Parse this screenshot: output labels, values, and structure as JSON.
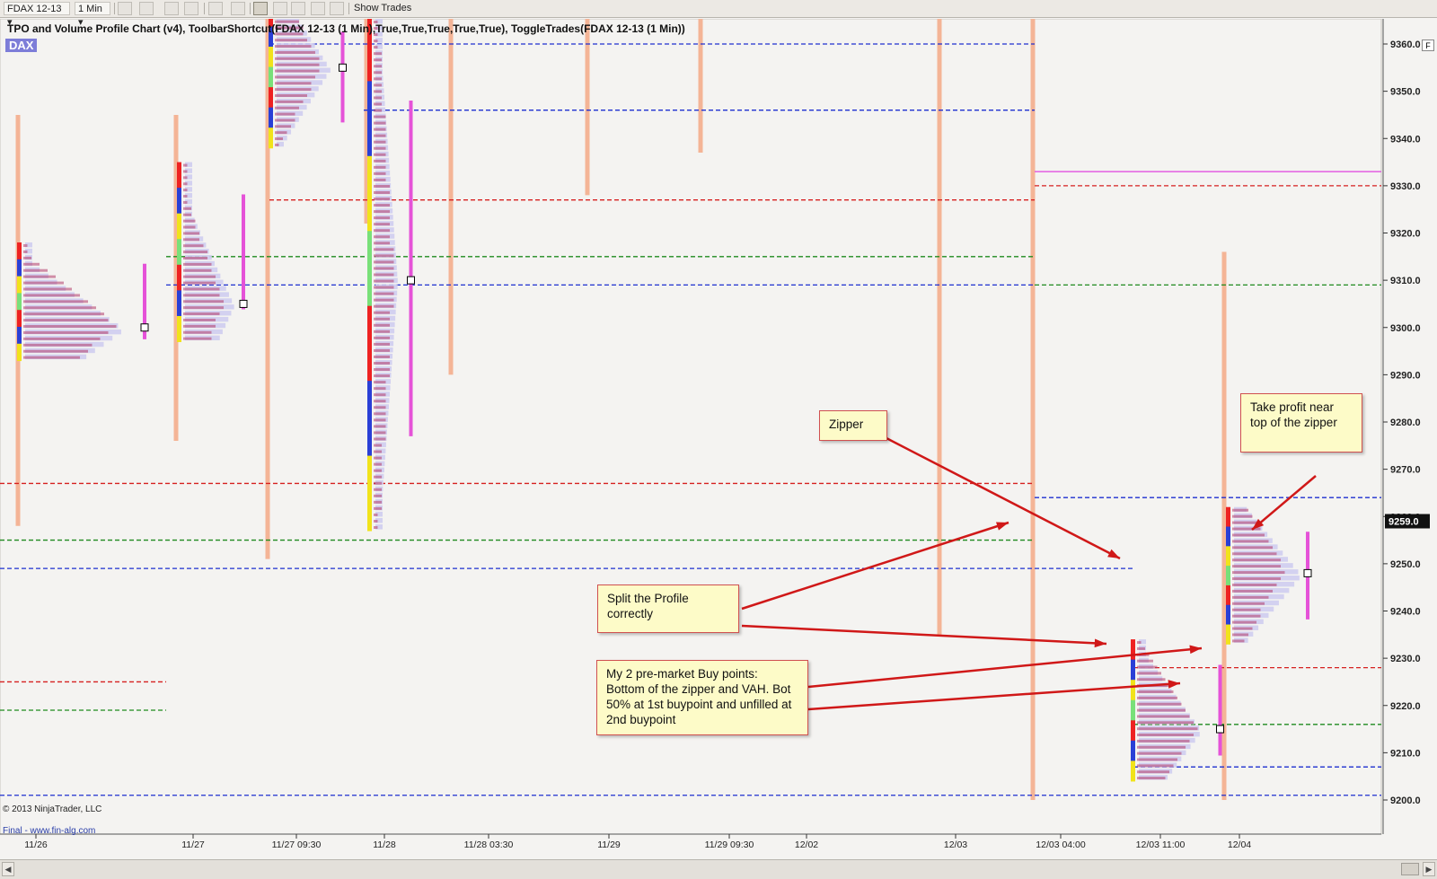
{
  "toolbar": {
    "instrument": "FDAX 12-13",
    "interval": "1 Min",
    "show_trades": "Show Trades"
  },
  "chart": {
    "title": "TPO and Volume Profile Chart (v4), ToolbarShortcut(FDAX 12-13 (1 Min),True,True,True,True,True), ToggleTrades(FDAX 12-13 (1 Min))",
    "instrument_label": "DAX",
    "copyright": "© 2013 NinjaTrader, LLC",
    "footer_link": "Final - www.fin-alg.com",
    "current_price_label": "9259.0",
    "corner_label": "F"
  },
  "chart_data": {
    "type": "tpo-profile",
    "ylim": [
      9197,
      9368
    ],
    "y_ticks": [
      9200,
      9210,
      9220,
      9230,
      9240,
      9250,
      9260,
      9270,
      9280,
      9290,
      9300,
      9310,
      9320,
      9330,
      9340,
      9350,
      9360
    ],
    "y_tick_labels": [
      "9200.0",
      "9210.0",
      "9220.0",
      "9230.0",
      "9240.0",
      "9250.0",
      "9260.0",
      "9270.0",
      "9280.0",
      "9290.0",
      "9300.0",
      "9310.0",
      "9320.0",
      "9330.0",
      "9340.0",
      "9350.0",
      "9360.0"
    ],
    "x_tick_labels": [
      "11/26",
      "11/27",
      "11/27 09:30",
      "11/28",
      "11/28 03:30",
      "11/29",
      "11/29 09:30",
      "12/02",
      "12/03",
      "12/03 04:00",
      "12/03 11:00",
      "12/04"
    ],
    "current_price": 9259.0,
    "range_bars": [
      {
        "high": 9345,
        "low": 9258,
        "color": "#f4b496"
      },
      {
        "high": 9345,
        "low": 9276,
        "color": "#f4b496"
      },
      {
        "high": 9368,
        "low": 9251,
        "color": "#f4b496"
      },
      {
        "high": 9368,
        "low": 9322,
        "color": "#f4b496"
      },
      {
        "high": 9368,
        "low": 9290,
        "color": "#f4b496"
      },
      {
        "high": 9368,
        "low": 9328,
        "color": "#f4b496"
      },
      {
        "high": 9368,
        "low": 9337,
        "color": "#f4b496"
      },
      {
        "high": 9368,
        "low": 9235,
        "color": "#f4b496"
      },
      {
        "high": 9368,
        "low": 9200,
        "color": "#f4b496"
      },
      {
        "high": 9316,
        "low": 9200,
        "color": "#f4b496"
      }
    ],
    "levels": [
      {
        "price": 9360,
        "color": "#1d2fd0",
        "from": "11/27 09:30",
        "to": "12/03 04:00"
      },
      {
        "price": 9346,
        "color": "#1d2fd0",
        "from": "11/28",
        "to": "12/03 04:00"
      },
      {
        "price": 9330,
        "color": "#d62020",
        "from": "12/03 04:00",
        "to": "end"
      },
      {
        "price": 9327,
        "color": "#d62020",
        "from": "11/27 09:30",
        "to": "12/03 04:00"
      },
      {
        "price": 9315,
        "color": "#1e8a1e",
        "from": "11/27",
        "to": "12/03 04:00"
      },
      {
        "price": 9309,
        "color": "#1d2fd0",
        "from": "11/27",
        "to": "12/03 04:00"
      },
      {
        "price": 9309,
        "color": "#1e8a1e",
        "from": "12/03 04:00",
        "to": "end"
      },
      {
        "price": 9267,
        "color": "#d62020",
        "from": "start",
        "to": "12/03 04:00"
      },
      {
        "price": 9264,
        "color": "#1d2fd0",
        "from": "12/03 04:00",
        "to": "end"
      },
      {
        "price": 9255,
        "color": "#1e8a1e",
        "from": "start",
        "to": "12/03 04:00"
      },
      {
        "price": 9249,
        "color": "#1d2fd0",
        "from": "start",
        "to": "12/03 11:00"
      },
      {
        "price": 9228,
        "color": "#d62020",
        "from": "12/03 11:00",
        "to": "end"
      },
      {
        "price": 9225,
        "color": "#d62020",
        "from": "start",
        "to": "11/27"
      },
      {
        "price": 9219,
        "color": "#1e8a1e",
        "from": "start",
        "to": "11/27"
      },
      {
        "price": 9216,
        "color": "#1e8a1e",
        "from": "12/03 11:00",
        "to": "end"
      },
      {
        "price": 9207,
        "color": "#1d2fd0",
        "from": "12/03 11:00",
        "to": "end"
      },
      {
        "price": 9201,
        "color": "#1d2fd0",
        "from": "start",
        "to": "end"
      },
      {
        "price": 9333,
        "color": "#e040e0",
        "from": "12/03 04:00",
        "to": "end"
      }
    ],
    "profiles": [
      {
        "top": 9318,
        "bottom": 9293,
        "poc": 9300
      },
      {
        "top": 9335,
        "bottom": 9297,
        "poc": 9305
      },
      {
        "top": 9368,
        "bottom": 9338,
        "poc": 9355
      },
      {
        "top": 9368,
        "bottom": 9257,
        "poc": 9310
      },
      {
        "top": 9234,
        "bottom": 9204,
        "poc": 9215
      },
      {
        "top": 9262,
        "bottom": 9233,
        "poc": 9248
      }
    ]
  },
  "annotations": [
    {
      "text": "Zipper"
    },
    {
      "text": "Take profit near top of the zipper"
    },
    {
      "text": "Split the Profile correctly"
    },
    {
      "text": "My 2 pre-market Buy points: Bottom of the zipper and VAH. Bot 50% at 1st buypoint and unfilled at 2nd buypoint"
    }
  ]
}
